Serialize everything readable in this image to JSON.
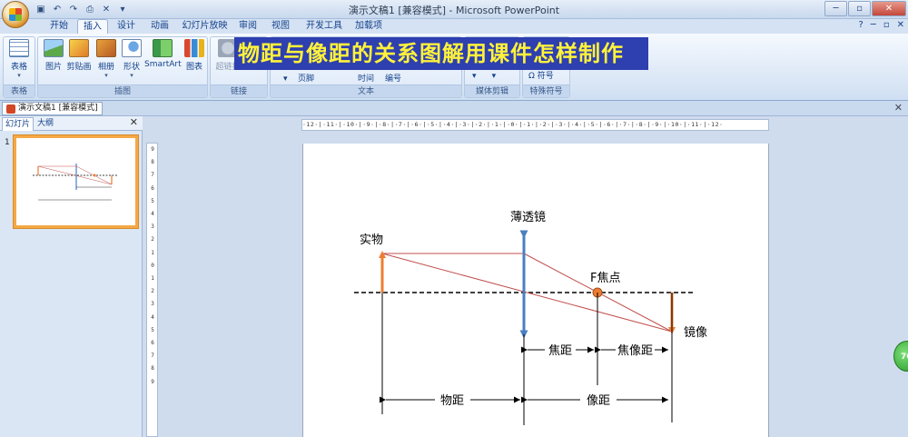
{
  "window": {
    "title": "演示文稿1 [兼容模式] - Microsoft PowerPoint",
    "quick_access": [
      "save",
      "undo",
      "redo",
      "print-preview",
      "close-doc",
      "customize"
    ],
    "controls": {
      "minimize": "─",
      "restore": "▫",
      "close": "✕"
    }
  },
  "tabs": [
    "开始",
    "插入",
    "设计",
    "动画",
    "幻灯片放映",
    "审阅",
    "视图",
    "开发工具",
    "加载项"
  ],
  "active_tab": "插入",
  "help_icons": [
    "?",
    "─",
    "▫",
    "✕"
  ],
  "ribbon": {
    "groups": [
      {
        "label": "表格",
        "buttons": [
          {
            "label": "表格",
            "icon": "table-icon"
          }
        ]
      },
      {
        "label": "插图",
        "buttons": [
          {
            "label": "图片",
            "icon": "picture-icon"
          },
          {
            "label": "剪贴画",
            "icon": "clipart-icon"
          },
          {
            "label": "相册",
            "icon": "album-icon"
          },
          {
            "label": "形状",
            "icon": "shapes-icon"
          },
          {
            "label": "SmartArt",
            "icon": "smartart-icon"
          },
          {
            "label": "图表",
            "icon": "chart-icon"
          }
        ]
      },
      {
        "label": "链接",
        "buttons": [
          {
            "label": "超链接",
            "icon": "hyperlink-icon"
          }
        ]
      },
      {
        "label": "文本",
        "buttons": [
          {
            "label": "页脚"
          },
          {
            "label": "时间"
          },
          {
            "label": "编号"
          }
        ]
      },
      {
        "label": "媒体剪辑",
        "buttons": []
      },
      {
        "label": "特殊符号",
        "buttons": [
          {
            "label": "符号"
          }
        ]
      }
    ]
  },
  "banner": "物距与像距的关系图解用课件怎样制作",
  "document_tab": "演示文稿1 [兼容模式]",
  "left_pane": {
    "tabs": [
      "幻灯片",
      "大纲"
    ],
    "slide_number": "1"
  },
  "rulers": {
    "horizontal": "·12·|·11·|·10·|·9·|·8·|·7·|·6·|·5·|·4·|·3·|·2·|·1·|·0·|·1·|·2·|·3·|·4·|·5·|·6·|·7·|·8·|·9·|·10·|·11·|·12·",
    "vertical": [
      "9",
      "8",
      "7",
      "6",
      "5",
      "4",
      "3",
      "2",
      "1",
      "0",
      "1",
      "2",
      "3",
      "4",
      "5",
      "6",
      "7",
      "8",
      "9"
    ]
  },
  "slide": {
    "labels": {
      "lens": "薄透镜",
      "object": "实物",
      "focus": "F焦点",
      "image": "镜像",
      "focal_length": "焦距",
      "focus_image_distance": "焦像距",
      "object_distance": "物距",
      "image_distance": "像距"
    },
    "colors": {
      "arrow_orange": "#ed7d31",
      "lens_blue": "#4a7fc0",
      "ray_red": "#c0504d",
      "focus_dot": "#ed7d31"
    }
  },
  "zoom_badge": "76"
}
